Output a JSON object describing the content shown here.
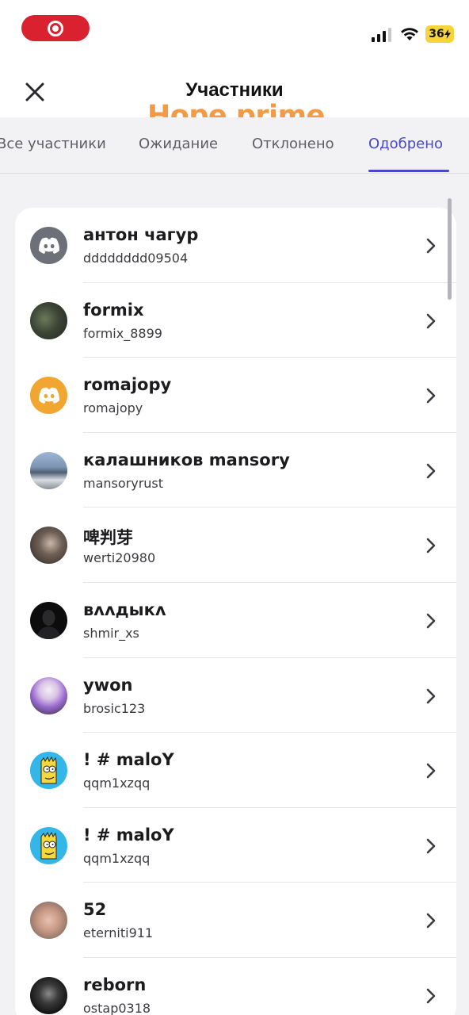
{
  "header": {
    "title": "Участники",
    "watermark": "Hope prime"
  },
  "status_bar": {
    "battery": "36"
  },
  "tabs": [
    {
      "label": "Все участники",
      "active": false
    },
    {
      "label": "Ожидание",
      "active": false
    },
    {
      "label": "Отклонено",
      "active": false
    },
    {
      "label": "Одобрено",
      "active": true
    }
  ],
  "members": [
    {
      "name": "антон чагур",
      "username": "dddddddd09504",
      "avatar": "discord-gray-avatar"
    },
    {
      "name": "formix",
      "username": "formix_8899",
      "avatar": "photo-avatar"
    },
    {
      "name": "romajopy",
      "username": "romajopy",
      "avatar": "discord-orange-avatar"
    },
    {
      "name": "калашников mansory",
      "username": "mansoryrust",
      "avatar": "photo-avatar"
    },
    {
      "name": "啤判芽",
      "username": "werti20980",
      "avatar": "photo-avatar"
    },
    {
      "name": "ʙʌʌдыкʌ",
      "username": "shmir_xs",
      "avatar": "silhouette-avatar"
    },
    {
      "name": "ywon",
      "username": "brosic123",
      "avatar": "anime-avatar"
    },
    {
      "name": "! #  maloY",
      "username": "qqm1xzqq",
      "avatar": "cartoon-avatar"
    },
    {
      "name": "! #  maloY",
      "username": "qqm1xzqq",
      "avatar": "cartoon-avatar"
    },
    {
      "name": "52",
      "username": "eterniti911",
      "avatar": "photo-avatar"
    },
    {
      "name": "reborn",
      "username": "ostap0318",
      "avatar": "photo-avatar"
    }
  ],
  "colors": {
    "accent": "#4848c8",
    "watermark": "#f29a46",
    "record": "#d9212f",
    "discord_gray": "#6d7079",
    "discord_orange": "#f0a631"
  }
}
